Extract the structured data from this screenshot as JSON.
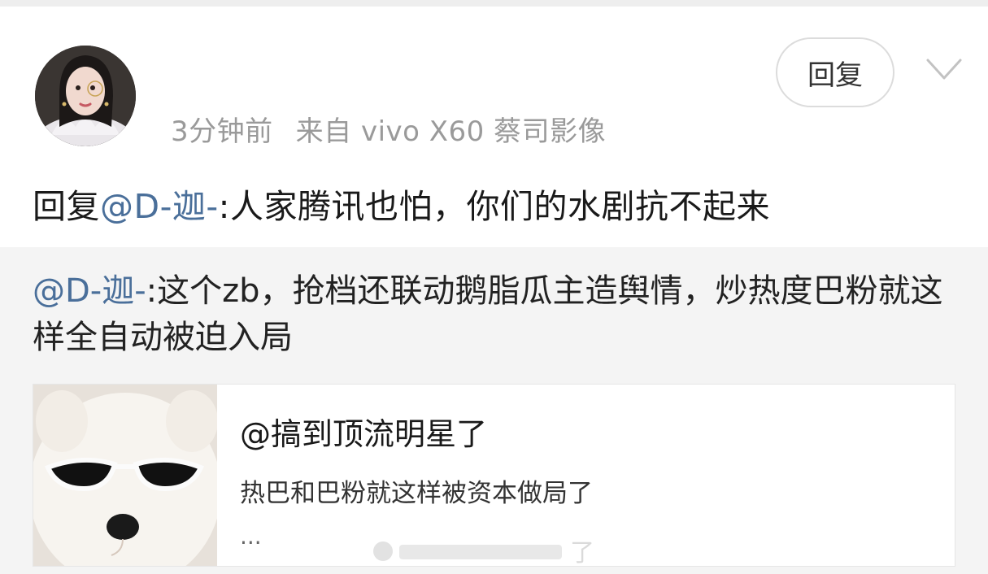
{
  "post": {
    "time": "3分钟前",
    "source": "来自 vivo X60 蔡司影像",
    "reply_button_label": "回复",
    "more_icon": "chevron-down-icon",
    "reply": {
      "prefix": "回复",
      "mention": "@D-迦-",
      "text": ":人家腾讯也怕，你们的水剧抗不起来"
    }
  },
  "quoted": {
    "mention": "@D-迦-",
    "text": ":这个zb，抢档还联动鹅脂瓜主造舆情，炒热度巴粉就这样全自动被迫入局"
  },
  "card": {
    "title": "@搞到顶流明星了",
    "description": "热巴和巴粉就这样被资本做局了",
    "ellipsis": "..."
  },
  "watermark": {
    "visible_char": "了"
  },
  "colors": {
    "mention": "#4a6f9a",
    "quoted_background": "#f4f4f4",
    "meta_text": "#9a9a9a"
  }
}
